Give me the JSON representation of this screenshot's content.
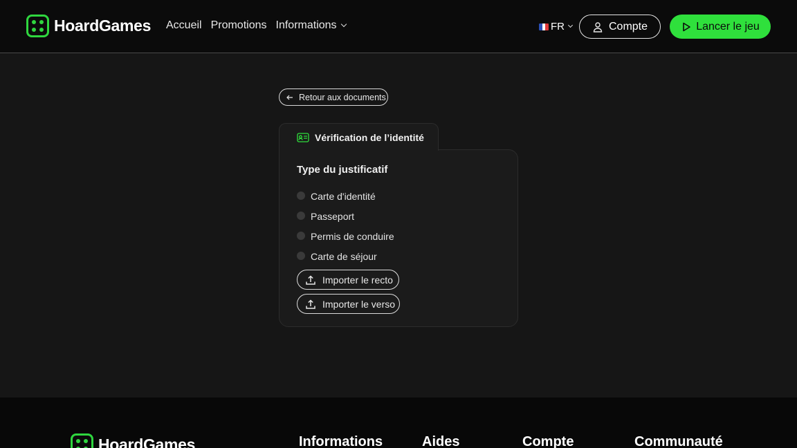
{
  "brand": {
    "name": "HoardGames",
    "accent": "#2fe03c",
    "logo_icon": "dice-logo-icon"
  },
  "nav": {
    "items": [
      "Accueil",
      "Promotions",
      "Informations"
    ]
  },
  "language": {
    "code": "FR",
    "flag": "france-flag-icon"
  },
  "header": {
    "account_label": "Compte",
    "play_label": "Lancer le jeu"
  },
  "back": {
    "label": "Retour aux documents"
  },
  "verification": {
    "tab_label": "Vérification de l’identité",
    "doc_type_title": "Type du justificatif",
    "options": [
      "Carte d'identité",
      "Passeport",
      "Permis de conduire",
      "Carte de séjour"
    ],
    "upload_front": "Importer le recto",
    "upload_back": "Importer le verso"
  },
  "footer": {
    "columns": [
      "Informations",
      "Aides",
      "Compte",
      "Communauté"
    ]
  }
}
